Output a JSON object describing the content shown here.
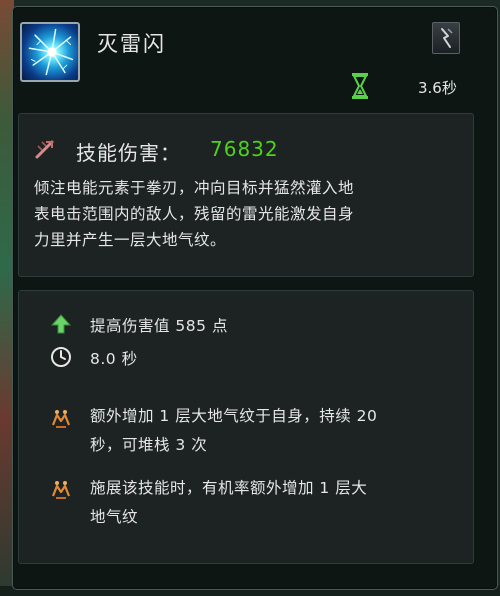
{
  "skill": {
    "name": "灭雷闪",
    "icon": "lightning-burst-icon",
    "type_icon": "lightning-claw-icon",
    "cooldown_icon": "hourglass-icon",
    "cooldown": "3.6秒"
  },
  "damage": {
    "icon": "damage-icon",
    "label": "技能伤害：",
    "value": "76832",
    "value_color": "#4fd21b"
  },
  "description": {
    "lines": [
      "倾注电能元素于拳刃，冲向目标并猛然灌入地",
      "表电击范围内的敌人，残留的雷光能激发自身",
      "力里并产生一层大地气纹。"
    ]
  },
  "stats": [
    {
      "icon": "green-up-arrow-icon",
      "text": "提高伤害值 585 点"
    },
    {
      "icon": "clock-icon",
      "text": "8.0 秒"
    }
  ],
  "effects": [
    {
      "icon": "earth-rune-icon",
      "lines": [
        "额外增加 1 层大地气纹于自身，持续 20",
        "秒，可堆栈 3 次"
      ]
    },
    {
      "icon": "earth-rune-icon",
      "lines": [
        "施展该技能时，有机率额外增加 1 层大",
        "地气纹"
      ]
    }
  ]
}
